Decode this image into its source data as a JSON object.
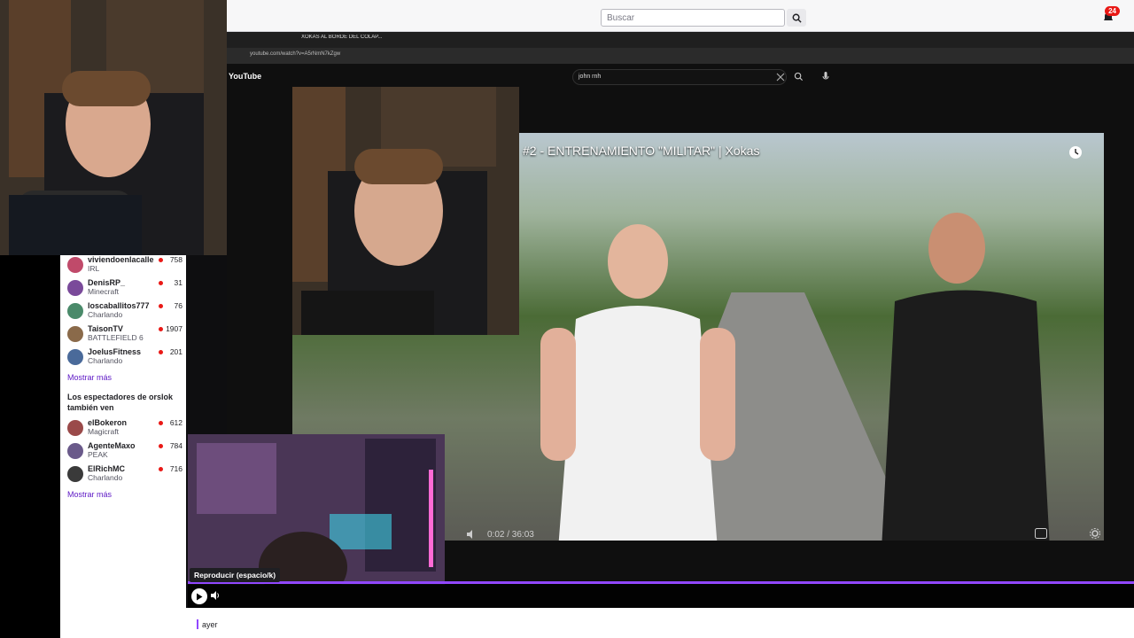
{
  "header": {
    "search_placeholder": "Buscar",
    "notifications_count": "24"
  },
  "inner_browser": {
    "tabs": [
      "",
      "XOKAS AL BORDE DEL COLAP...",
      "",
      "",
      "",
      ""
    ],
    "url": "youtube.com/watch?v=A5rNmN7kZgw",
    "yt_search_value": "john rnh",
    "yt_logo": "YouTube"
  },
  "video": {
    "title": "#2 - ENTRENAMIENTO \"MILITAR\" | Xokas",
    "time": "0:02 / 36:03"
  },
  "sidebar": {
    "channels_top": [
      {
        "name": "viviendoenlacalle",
        "game": "IRL",
        "count": "758",
        "color": "#c04a6a"
      },
      {
        "name": "DenisRP_",
        "game": "Minecraft",
        "count": "31",
        "color": "#7a4a9a"
      },
      {
        "name": "loscaballitos777",
        "game": "Charlando",
        "count": "76",
        "color": "#4a8a6a"
      },
      {
        "name": "TaisonTV",
        "game": "BATTLEFIELD 6",
        "count": "1907",
        "color": "#8a6a4a"
      },
      {
        "name": "JoelusFitness",
        "game": "Charlando",
        "count": "201",
        "color": "#4a6a9a"
      }
    ],
    "more_label_1": "Mostrar más",
    "also_watch_title": "Los espectadores de orslok también ven",
    "channels_also": [
      {
        "name": "elBokeron",
        "game": "Magicraft",
        "count": "612",
        "color": "#9a4a4a"
      },
      {
        "name": "AgenteMaxo",
        "game": "PEAK",
        "count": "784",
        "color": "#6a5a8a"
      },
      {
        "name": "ElRichMC",
        "game": "Charlando",
        "count": "716",
        "color": "#3a3a3a"
      }
    ],
    "more_label_2": "Mostrar más"
  },
  "player": {
    "tooltip": "Reproducir (espacio/k)",
    "progress_fraction": 1.0
  },
  "bottom": {
    "date_label": "ayer"
  },
  "colors": {
    "accent": "#9147ff",
    "live": "#e91916"
  }
}
